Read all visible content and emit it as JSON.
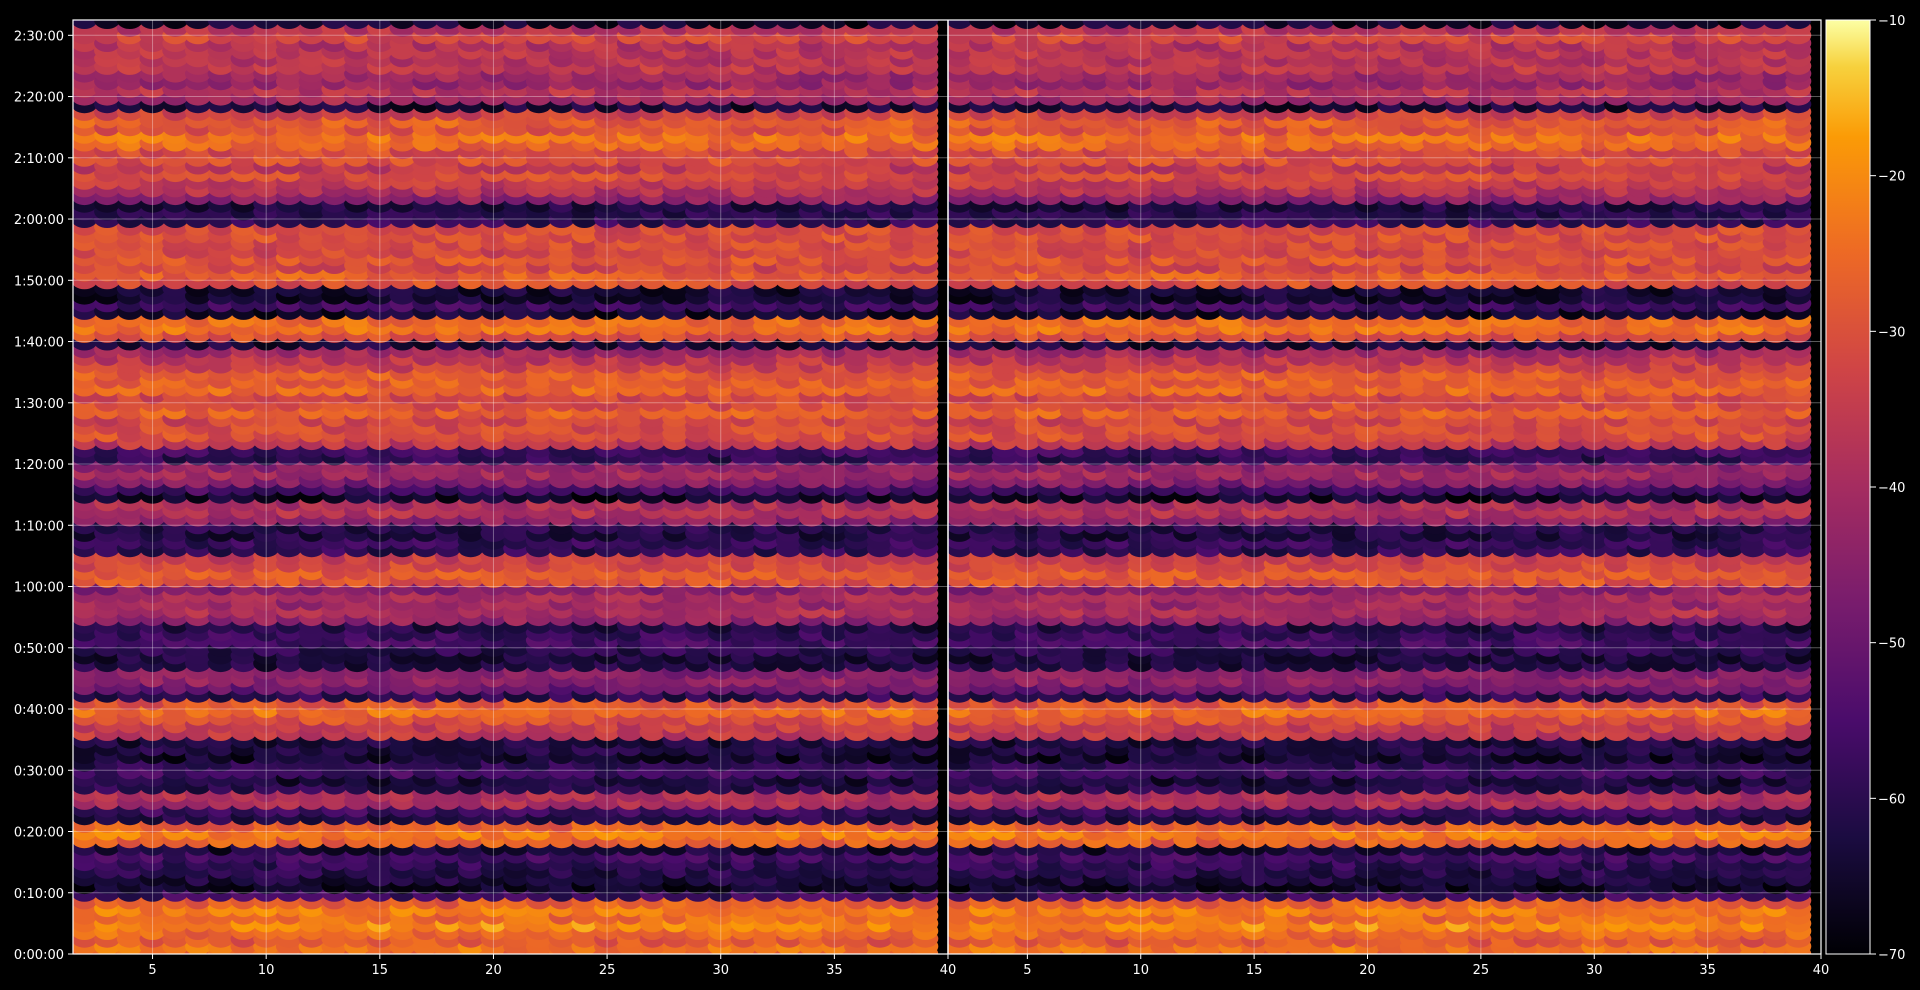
{
  "chart_data": {
    "type": "heatmap",
    "title": "",
    "xlabel": "",
    "ylabel": "",
    "panels": 2,
    "x_range": [
      1.5,
      40
    ],
    "x_ticks": [
      5,
      10,
      15,
      20,
      25,
      30,
      35,
      40
    ],
    "y_range_seconds": [
      0,
      9150
    ],
    "y_ticks": [
      "0:00:00",
      "0:10:00",
      "0:20:00",
      "0:30:00",
      "0:40:00",
      "0:50:00",
      "1:00:00",
      "1:10:00",
      "1:20:00",
      "1:30:00",
      "1:40:00",
      "1:50:00",
      "2:00:00",
      "2:10:00",
      "2:20:00",
      "2:30:00"
    ],
    "colorbar": {
      "colormap": "inferno",
      "range": [
        -70,
        -10
      ],
      "ticks": [
        -10,
        -20,
        -30,
        -40,
        -50,
        -60,
        -70
      ]
    },
    "grid": true,
    "channel_columns": 38,
    "strong_bands": [
      {
        "time_seconds": 60,
        "level": -22
      },
      {
        "time_seconds": 300,
        "level": -20
      },
      {
        "time_seconds": 450,
        "level": -22
      },
      {
        "time_seconds": 1200,
        "level": -22
      },
      {
        "time_seconds": 1540,
        "level": -36
      },
      {
        "time_seconds": 2400,
        "level": -24
      },
      {
        "time_seconds": 2220,
        "level": -32
      },
      {
        "time_seconds": 2730,
        "level": -42
      },
      {
        "time_seconds": 3370,
        "level": -38
      },
      {
        "time_seconds": 3500,
        "level": -38
      },
      {
        "time_seconds": 3720,
        "level": -26
      },
      {
        "time_seconds": 3840,
        "level": -30
      },
      {
        "time_seconds": 4380,
        "level": -36
      },
      {
        "time_seconds": 4740,
        "level": -40
      },
      {
        "time_seconds": 5130,
        "level": -28
      },
      {
        "time_seconds": 5340,
        "level": -26
      },
      {
        "time_seconds": 5580,
        "level": -24
      },
      {
        "time_seconds": 5700,
        "level": -28
      },
      {
        "time_seconds": 5850,
        "level": -36
      },
      {
        "time_seconds": 6180,
        "level": -22
      },
      {
        "time_seconds": 6660,
        "level": -26
      },
      {
        "time_seconds": 6840,
        "level": -28
      },
      {
        "time_seconds": 6960,
        "level": -30
      },
      {
        "time_seconds": 7080,
        "level": -28
      },
      {
        "time_seconds": 7500,
        "level": -38
      },
      {
        "time_seconds": 7640,
        "level": -30
      },
      {
        "time_seconds": 7830,
        "level": -28
      },
      {
        "time_seconds": 8000,
        "level": -22
      },
      {
        "time_seconds": 8160,
        "level": -26
      },
      {
        "time_seconds": 8460,
        "level": -36
      },
      {
        "time_seconds": 8700,
        "level": -36
      },
      {
        "time_seconds": 8820,
        "level": -34
      },
      {
        "time_seconds": 9000,
        "level": -32
      }
    ]
  }
}
